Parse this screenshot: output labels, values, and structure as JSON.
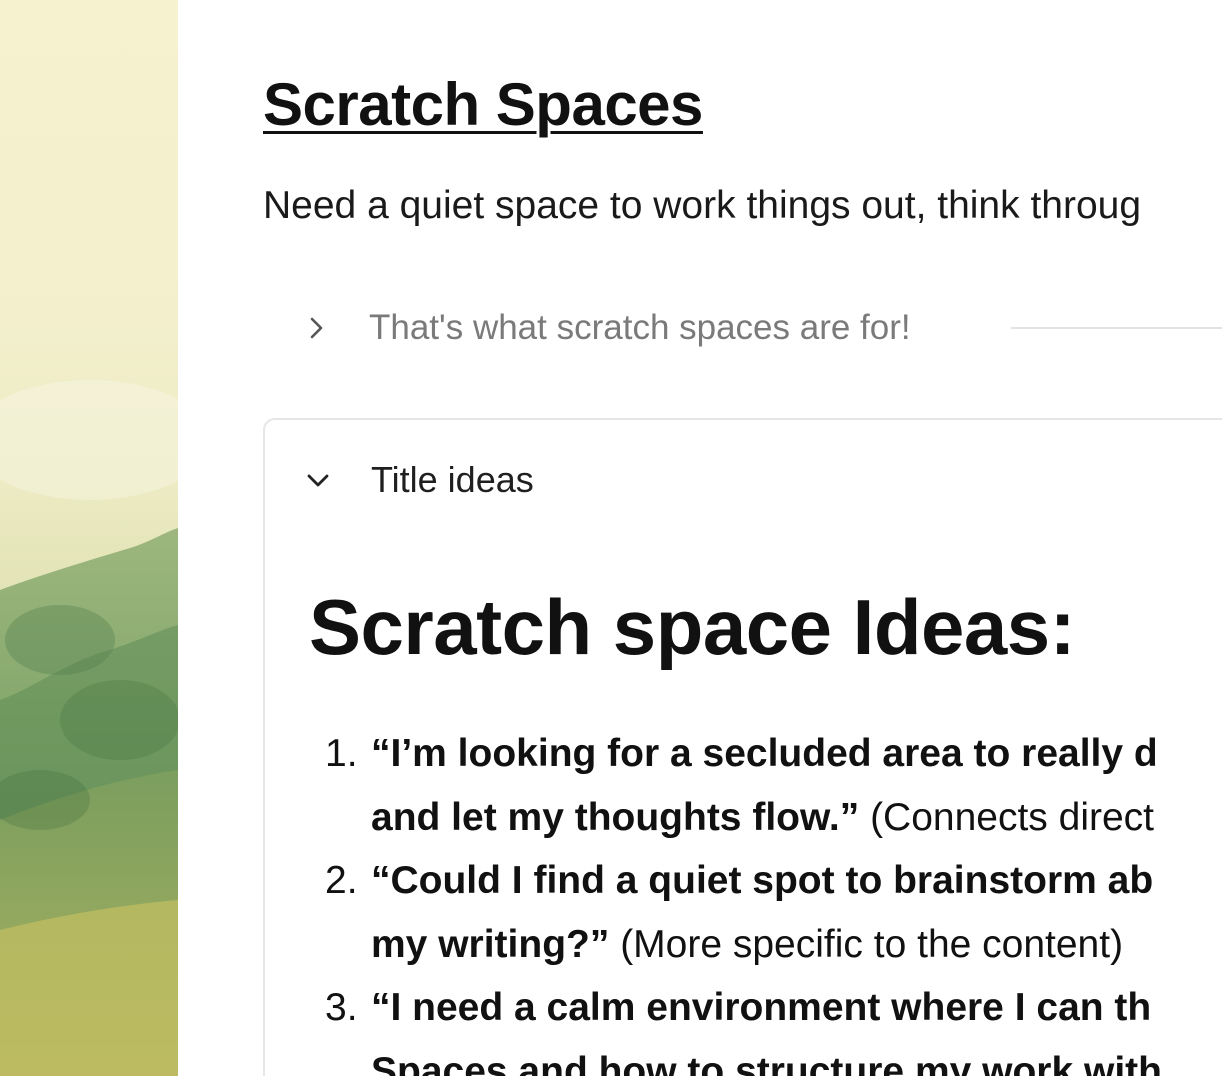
{
  "page": {
    "title": "Scratch Spaces",
    "intro": "Need a quiet space to work things out, think throug"
  },
  "toggle_closed": {
    "label": "That's what scratch spaces are for!",
    "icon": "chevron-right-icon"
  },
  "title_ideas": {
    "toggle_label": "Title ideas",
    "icon": "chevron-down-icon",
    "heading": "Scratch space Ideas:",
    "items": [
      {
        "number": "1.",
        "line1": "“I’m looking for a secluded area to really d",
        "line2_quote": "and let my thoughts flow.”",
        "line2_note": "(Connects direct"
      },
      {
        "number": "2.",
        "line1": "“Could I find a quiet spot to brainstorm ab",
        "line2_quote": "my writing?”",
        "line2_note": "(More specific to the content)"
      },
      {
        "number": "3.",
        "line1": "“I need a calm environment where I can th",
        "line2_quote": "Spaces and how to structure my work with",
        "line2_note": ""
      }
    ]
  },
  "colors": {
    "text": "#111111",
    "muted": "#7a7a7a",
    "border": "#e6e6e6"
  }
}
